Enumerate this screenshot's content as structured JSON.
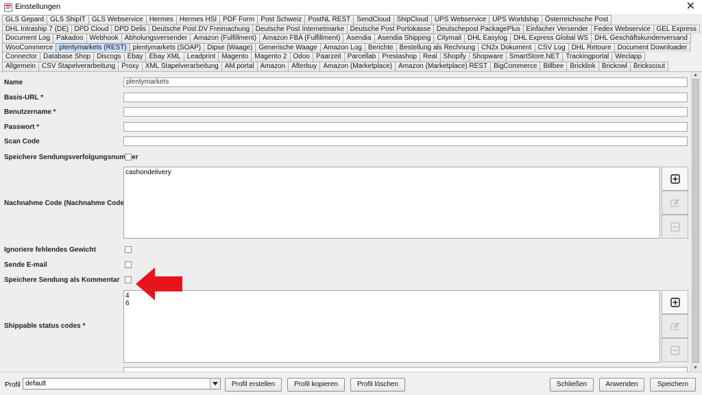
{
  "window": {
    "title": "Einstellungen"
  },
  "tab_rows": [
    [
      "GLS Gepard",
      "GLS ShipIT",
      "GLS Webservice",
      "Hermes",
      "Hermes HSI",
      "PDF Form",
      "Post Schweiz",
      "PostNL REST",
      "SendCloud",
      "ShipCloud",
      "UPS Webservice",
      "UPS Worldship",
      "Österreichische Post"
    ],
    [
      "DHL Intraship 7 (DE)",
      "DPD Cloud",
      "DPD Delis",
      "Deutsche Post DV Freimachung",
      "Deutsche Post Internetmarke",
      "Deutsche Post Portokasse",
      "Deutschepost PackagePlus",
      "Einfacher Versender",
      "Fedex Webservice",
      "GEL Express"
    ],
    [
      "Document Log",
      "Pakadoo",
      "Webhook",
      "Abholungsversender",
      "Amazon (Fulfillment)",
      "Amazon FBA (Fulfillment)",
      "Asendia",
      "Asendia Shipping",
      "Citymail",
      "DHL Easylog",
      "DHL Express Global WS",
      "DHL Geschäftskundenversand"
    ],
    [
      "WooCommerce",
      "plentymarkets (REST)",
      "plentymarkets (SOAP)",
      "Dipse (Waage)",
      "Generische Waage",
      "Amazon Log",
      "Berichte",
      "Bestellung als Rechnung",
      "CN2x Dokument",
      "CSV Log",
      "DHL Retoure",
      "Document Downloader"
    ],
    [
      "Connector",
      "Database Shop",
      "Discogs",
      "Ebay",
      "Ebay XML",
      "Leadprint",
      "Magento",
      "Magento 2",
      "Odoo",
      "Paarzeit",
      "Parcellab",
      "Prestashop",
      "Real",
      "Shopify",
      "Shopware",
      "SmartStore.NET",
      "Trackingportal",
      "Weclapp"
    ],
    [
      "Allgemein",
      "CSV Stapelverarbeitung",
      "Proxy",
      "XML Stapelverarbeitung",
      "AM.portal",
      "Amazon",
      "Afterbuy",
      "Amazon (Marketplace)",
      "Amazon (Marketplace) REST",
      "BigCommerce",
      "Billbee",
      "Bricklink",
      "Brickowl",
      "Brickscout"
    ]
  ],
  "active_tab": "plentymarkets (REST)",
  "form": {
    "name_label": "Name",
    "name_value": "plentymarkets",
    "base_url_label": "Basis-URL *",
    "base_url_value": "",
    "username_label": "Benutzername *",
    "username_value": "",
    "password_label": "Passwort *",
    "password_value": "",
    "scan_code_label": "Scan Code",
    "scan_code_value": "",
    "save_tracking_label": "Speichere Sendungsverfolgungsnummer",
    "cod_label": "Nachnahme Code (Nachnahme Code)",
    "cod_items": [
      "cashondelivery"
    ],
    "ignore_weight_label": "Ignoriere fehlendes Gewicht",
    "send_email_label": "Sende E-mail",
    "save_comment_label": "Speichere Sendung als Kommentar",
    "shippable_label": "Shippable status codes *",
    "shippable_items": [
      "4",
      "6"
    ]
  },
  "bottom": {
    "profile_label": "Profil",
    "profile_value": "default",
    "create_profile": "Profil erstellen",
    "copy_profile": "Profil kopieren",
    "delete_profile": "Profil löschen",
    "close": "Schließen",
    "apply": "Anwenden",
    "save": "Speichern"
  },
  "colors": {
    "active_tab": "#cde1f5",
    "annotation_arrow": "#e8141c"
  },
  "icons": {
    "add": "plus-square-icon",
    "edit": "edit-icon",
    "remove": "minus-square-icon"
  }
}
